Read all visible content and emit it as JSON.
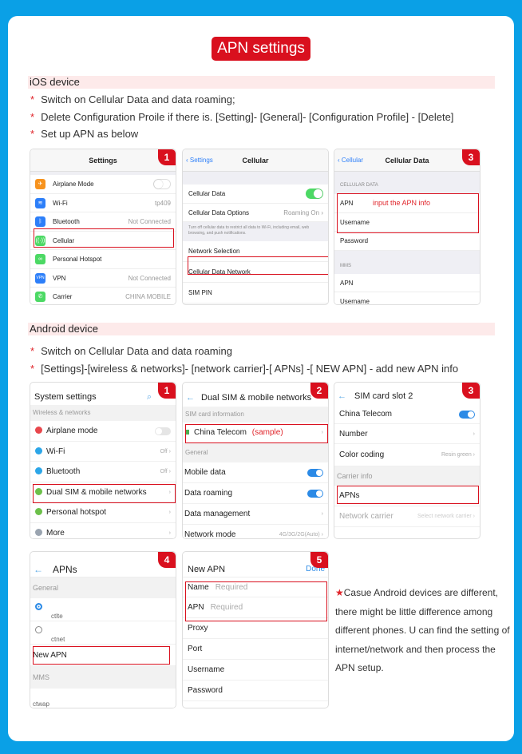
{
  "title": "APN settings",
  "ios": {
    "heading": "iOS device",
    "bullets": [
      "Switch on Cellular Data and data roaming;",
      "Delete Configuration Proile if there is. [Setting]- [General]- [Configuration Profile] - [Delete]",
      "Set up APN as below"
    ],
    "screen1": {
      "step": "1",
      "nav_title": "Settings",
      "rows": [
        {
          "label": "Airplane Mode",
          "value": ""
        },
        {
          "label": "Wi-Fi",
          "value": "tp409"
        },
        {
          "label": "Bluetooth",
          "value": "Not Connected"
        },
        {
          "label": "Cellular",
          "value": ""
        },
        {
          "label": "Personal Hotspot",
          "value": ""
        },
        {
          "label": "VPN",
          "value": "Not Connected"
        },
        {
          "label": "Carrier",
          "value": "CHINA MOBILE"
        }
      ],
      "icon_labels": {
        "vpn": "VPN"
      }
    },
    "screen2": {
      "step": "2",
      "back": "Settings",
      "nav_title": "Cellular",
      "cellular_data": "Cellular Data",
      "cellular_data_options": "Cellular Data Options",
      "roaming_value": "Roaming On",
      "footnote": "Turn off cellular data to restrict all data to Wi-Fi, including email, web browsing, and push notifications.",
      "network_selection": "Network Selection",
      "cellular_data_network": "Cellular Data Network",
      "sim_pin": "SIM PIN"
    },
    "screen3": {
      "step": "3",
      "back": "Cellular",
      "nav_title": "Cellular Data",
      "section1": "CELLULAR DATA",
      "apn": "APN",
      "hint": "input the APN info",
      "username": "Username",
      "password": "Password",
      "section2": "MMS",
      "mms_apn": "APN",
      "mms_username": "Username"
    }
  },
  "android": {
    "heading": "Android device",
    "bullets": [
      "Switch on Cellular Data and data roaming",
      "[Settings]-[wireless & networks]- [network carrier]-[ APNs] -[ NEW APN] - add new APN info"
    ],
    "screen1": {
      "step": "1",
      "title": "System settings",
      "section": "Wireless & networks",
      "rows": [
        {
          "label": "Airplane mode",
          "value": ""
        },
        {
          "label": "Wi-Fi",
          "value": "Off"
        },
        {
          "label": "Bluetooth",
          "value": "Off"
        },
        {
          "label": "Dual SIM & mobile networks",
          "value": ""
        },
        {
          "label": "Personal hotspot",
          "value": ""
        },
        {
          "label": "More",
          "value": ""
        }
      ]
    },
    "screen2": {
      "step": "2",
      "title": "Dual SIM & mobile networks",
      "section1": "SIM card information",
      "carrier": "China Telecom",
      "sample": "(sample)",
      "section2": "General",
      "mobile_data": "Mobile data",
      "data_roaming": "Data roaming",
      "data_management": "Data management",
      "network_mode": "Network mode",
      "network_mode_value": "4G/3G/2G(Auto)"
    },
    "screen3": {
      "step": "3",
      "title": "SIM card slot 2",
      "carrier": "China Telecom",
      "number": "Number",
      "color_coding": "Color coding",
      "color_value": "Resin green",
      "section": "Carrier info",
      "apns": "APNs",
      "network_carrier": "Network carrier",
      "network_carrier_value": "Select network carrier"
    },
    "screen4": {
      "step": "4",
      "title": "APNs",
      "section1": "General",
      "apn1": "ctlte",
      "apn2": "ctnet",
      "new_apn": "New APN",
      "section2": "MMS",
      "mms_apn": "ctwap"
    },
    "screen5": {
      "step": "5",
      "title": "New APN",
      "done": "Done",
      "name": "Name",
      "name_placeholder": "Required",
      "apn": "APN",
      "apn_placeholder": "Required",
      "proxy": "Proxy",
      "port": "Port",
      "username": "Username",
      "password": "Password"
    },
    "note": "Casue Android devices are different, there might be little difference among different phones. U can find the setting of internet/network and then process the APN setup."
  },
  "colors": {
    "accent_red": "#d9101e",
    "background_blue": "#0aa0e6",
    "ios_blue": "#2d7ff9",
    "android_blue": "#2b8ae6"
  }
}
